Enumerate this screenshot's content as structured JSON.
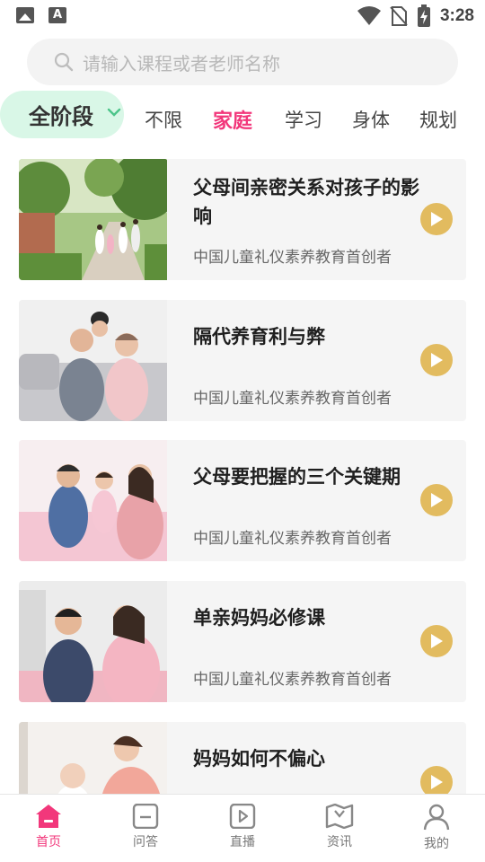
{
  "status_bar": {
    "time": "3:28",
    "left_icons": [
      "gallery-icon",
      "font-a-icon"
    ],
    "right_icons": [
      "wifi-icon",
      "no-sim-icon",
      "battery-charging-icon"
    ]
  },
  "search": {
    "placeholder": "请输入课程或者老师名称",
    "icon": "search-icon"
  },
  "categories": {
    "stage_selector": "全阶段",
    "tabs": [
      {
        "label": "不限",
        "active": false
      },
      {
        "label": "家庭",
        "active": true
      },
      {
        "label": "学习",
        "active": false
      },
      {
        "label": "身体",
        "active": false
      },
      {
        "label": "规划",
        "active": false
      }
    ]
  },
  "courses": [
    {
      "title": "父母间亲密关系对孩子的影响",
      "subtitle": "中国儿童礼仪素养教育首创者"
    },
    {
      "title": "隔代养育利与弊",
      "subtitle": "中国儿童礼仪素养教育首创者"
    },
    {
      "title": "父母要把握的三个关键期",
      "subtitle": "中国儿童礼仪素养教育首创者"
    },
    {
      "title": "单亲妈妈必修课",
      "subtitle": "中国儿童礼仪素养教育首创者"
    },
    {
      "title": "妈妈如何不偏心",
      "subtitle": ""
    }
  ],
  "bottom_nav": [
    {
      "label": "首页",
      "icon": "home-icon",
      "active": true
    },
    {
      "label": "问答",
      "icon": "qa-icon",
      "active": false
    },
    {
      "label": "直播",
      "icon": "live-play-icon",
      "active": false
    },
    {
      "label": "资讯",
      "icon": "news-book-icon",
      "active": false
    },
    {
      "label": "我的",
      "icon": "profile-icon",
      "active": false
    }
  ],
  "colors": {
    "accent": "#f2377b",
    "play_button": "#e2bb5f",
    "stage_selector_bg": "#d9f7e7"
  }
}
